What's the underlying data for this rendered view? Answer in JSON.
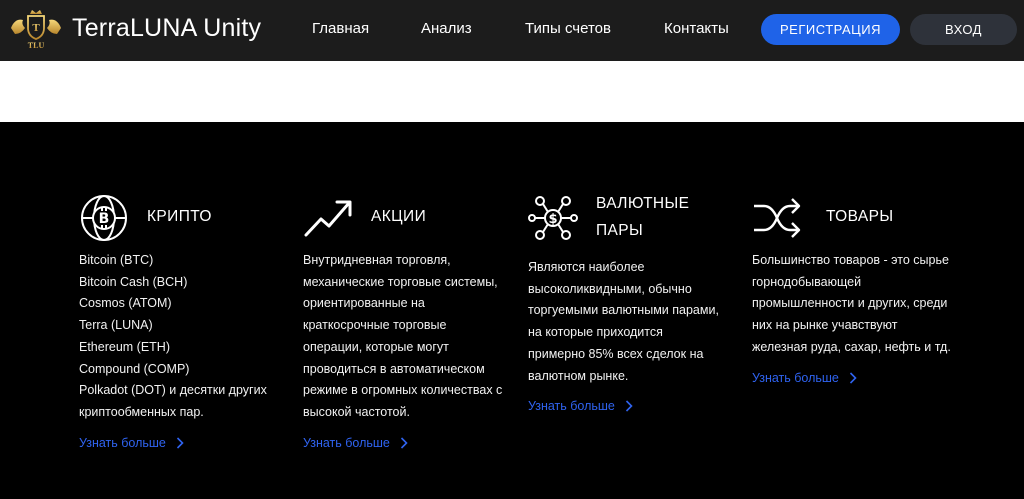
{
  "header": {
    "brand": "TerraLUNA Unity",
    "logo_text": "TLU",
    "nav": [
      "Главная",
      "Анализ",
      "Типы счетов",
      "Контакты"
    ],
    "register_label": "РЕГИСТРАЦИЯ",
    "login_label": "ВХОД"
  },
  "colors": {
    "accent": "#1f63e8",
    "link": "#2f63f0",
    "header_bg": "#1c1c1c",
    "bg": "#000000"
  },
  "sections": {
    "crypto": {
      "title": "КРИПТО",
      "items": [
        "Bitcoin (BTC)",
        "Bitcoin Cash (BCH)",
        "Cosmos (ATOM)",
        "Terra (LUNA)",
        "Ethereum (ETH)",
        "Compound (COMP)",
        "Polkadot (DOT) и десятки других криптообменных пар."
      ],
      "more": "Узнать больше"
    },
    "stocks": {
      "title": "АКЦИИ",
      "text": "Внутридневная торговля, механические торговые системы, ориентированные на краткосрочные торговые операции, которые могут проводиться в автоматическом режиме в огромных количествах с высокой частотой.",
      "more": "Узнать больше"
    },
    "forex": {
      "title_line1": "ВАЛЮТНЫЕ",
      "title_line2": "ПАРЫ",
      "text": "Являются наиболее высоколиквидными, обычно торгуемыми валютными парами, на которые приходится примерно 85% всех сделок на валютном рынке.",
      "more": "Узнать больше"
    },
    "commodities": {
      "title": "ТОВАРЫ",
      "text": "Большинство товаров - это сырье горнодобывающей промышленности и других, среди них на рынке учавствуют железная руда, сахар, нефть и тд.",
      "more": "Узнать больше"
    }
  },
  "icons": [
    "logo-crown-lions",
    "bitcoin-globe-icon",
    "trend-arrow-icon",
    "dollar-network-icon",
    "shuffle-arrows-icon",
    "chevron-right-icon"
  ]
}
